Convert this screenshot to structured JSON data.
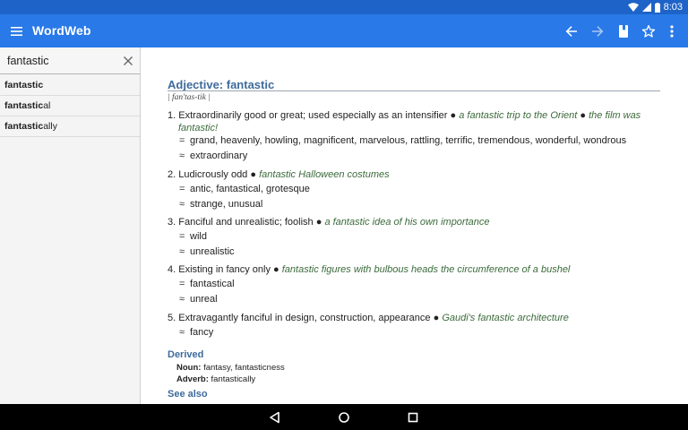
{
  "status": {
    "time": "8:03"
  },
  "app": {
    "title": "WordWeb"
  },
  "actions": {
    "back": "arrow-back-icon",
    "forward": "arrow-forward-icon",
    "bookmark": "bookmark-icon",
    "favorite": "star-icon",
    "more": "more-vert-icon"
  },
  "search": {
    "value": "fantastic",
    "placeholder": ""
  },
  "word_list": [
    {
      "prefix": "fantastic",
      "suffix": ""
    },
    {
      "prefix": "fantastic",
      "suffix": "al"
    },
    {
      "prefix": "fantastic",
      "suffix": "ally"
    }
  ],
  "entry": {
    "heading": "Adjective: fantastic",
    "pronunciation": "| fan'tas-tik |",
    "senses": [
      {
        "num": "1.",
        "def": "Extraordinarily good or great; used especially as an intensifier",
        "ex1": "a fantastic trip to the Orient",
        "ex2": "the film was",
        "ex2b": "fantastic!",
        "syn": "grand, heavenly, howling, magnificent, marvelous, rattling, terrific, tremendous, wonderful, wondrous",
        "sim": "extraordinary"
      },
      {
        "num": "2.",
        "def": "Ludicrously odd",
        "ex1": "fantastic Halloween costumes",
        "syn": "antic, fantastical, grotesque",
        "sim": "strange, unusual"
      },
      {
        "num": "3.",
        "def": "Fanciful and unrealistic; foolish",
        "ex1": "a fantastic idea of his own importance",
        "syn": "wild",
        "sim": "unrealistic"
      },
      {
        "num": "4.",
        "def": "Existing in fancy only",
        "ex1": "fantastic figures with bulbous heads the circumference of a bushel",
        "syn": "fantastical",
        "sim": "unreal"
      },
      {
        "num": "5.",
        "def": "Extravagantly fanciful in design, construction, appearance",
        "ex1": "Gaudi's fantastic architecture",
        "sim": "fancy"
      }
    ],
    "bullet": "●",
    "syn_symbol": "=",
    "sim_symbol": "≈",
    "derived": {
      "title": "Derived",
      "noun_label": "Noun:",
      "noun": "fantasy, fantasticness",
      "adverb_label": "Adverb:",
      "adverb": "fantastically"
    },
    "see_also": {
      "title": "See also"
    }
  },
  "nav": {
    "back": "nav-back-icon",
    "home": "nav-home-icon",
    "recents": "nav-recents-icon"
  }
}
